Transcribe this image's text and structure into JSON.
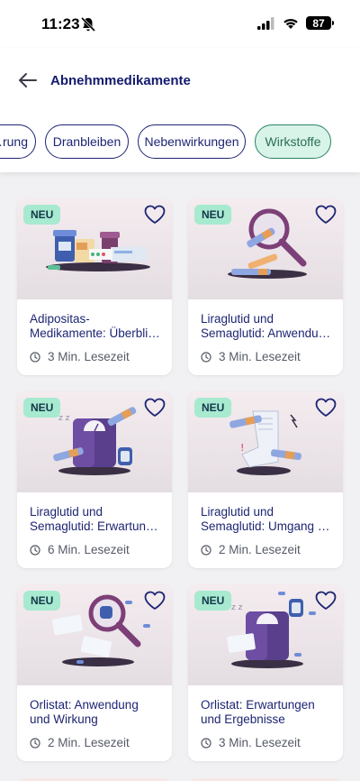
{
  "status": {
    "time": "11:23",
    "battery": "87"
  },
  "header": {
    "title": "Abnehmmedikamente"
  },
  "chips": [
    {
      "label": "…rung"
    },
    {
      "label": "Dranbleiben"
    },
    {
      "label": "Nebenwirkungen"
    },
    {
      "label": "Wirkstoffe",
      "active": true
    }
  ],
  "cards": [
    {
      "badge": "NEU",
      "title_line1": "Adipositas-",
      "title_line2": "Medikamente: Überbli…",
      "reading_time": "3 Min. Lesezeit",
      "illustration": "medication-packages"
    },
    {
      "badge": "NEU",
      "title_line1": "Liraglutid und",
      "title_line2": "Semaglutid: Anwendu…",
      "reading_time": "3 Min. Lesezeit",
      "illustration": "magnifier-pens"
    },
    {
      "badge": "NEU",
      "title_line1": "Liraglutid und",
      "title_line2": "Semaglutid: Erwartun…",
      "reading_time": "6 Min. Lesezeit",
      "illustration": "scale-pens-watch"
    },
    {
      "badge": "NEU",
      "title_line1": "Liraglutid und",
      "title_line2": "Semaglutid: Umgang …",
      "reading_time": "2 Min. Lesezeit",
      "illustration": "receipt-pens"
    },
    {
      "badge": "NEU",
      "title_line1": "Orlistat: Anwendung",
      "title_line2": "und Wirkung",
      "reading_time": "2 Min. Lesezeit",
      "illustration": "magnifier-orlistat"
    },
    {
      "badge": "NEU",
      "title_line1": "Orlistat: Erwartungen",
      "title_line2": "und Ergebnisse",
      "reading_time": "3 Min. Lesezeit",
      "illustration": "scale-orlistat"
    }
  ],
  "colors": {
    "navy": "#1d2573",
    "badge": "#a7ead0",
    "active_chip": "#d8f3e8"
  }
}
